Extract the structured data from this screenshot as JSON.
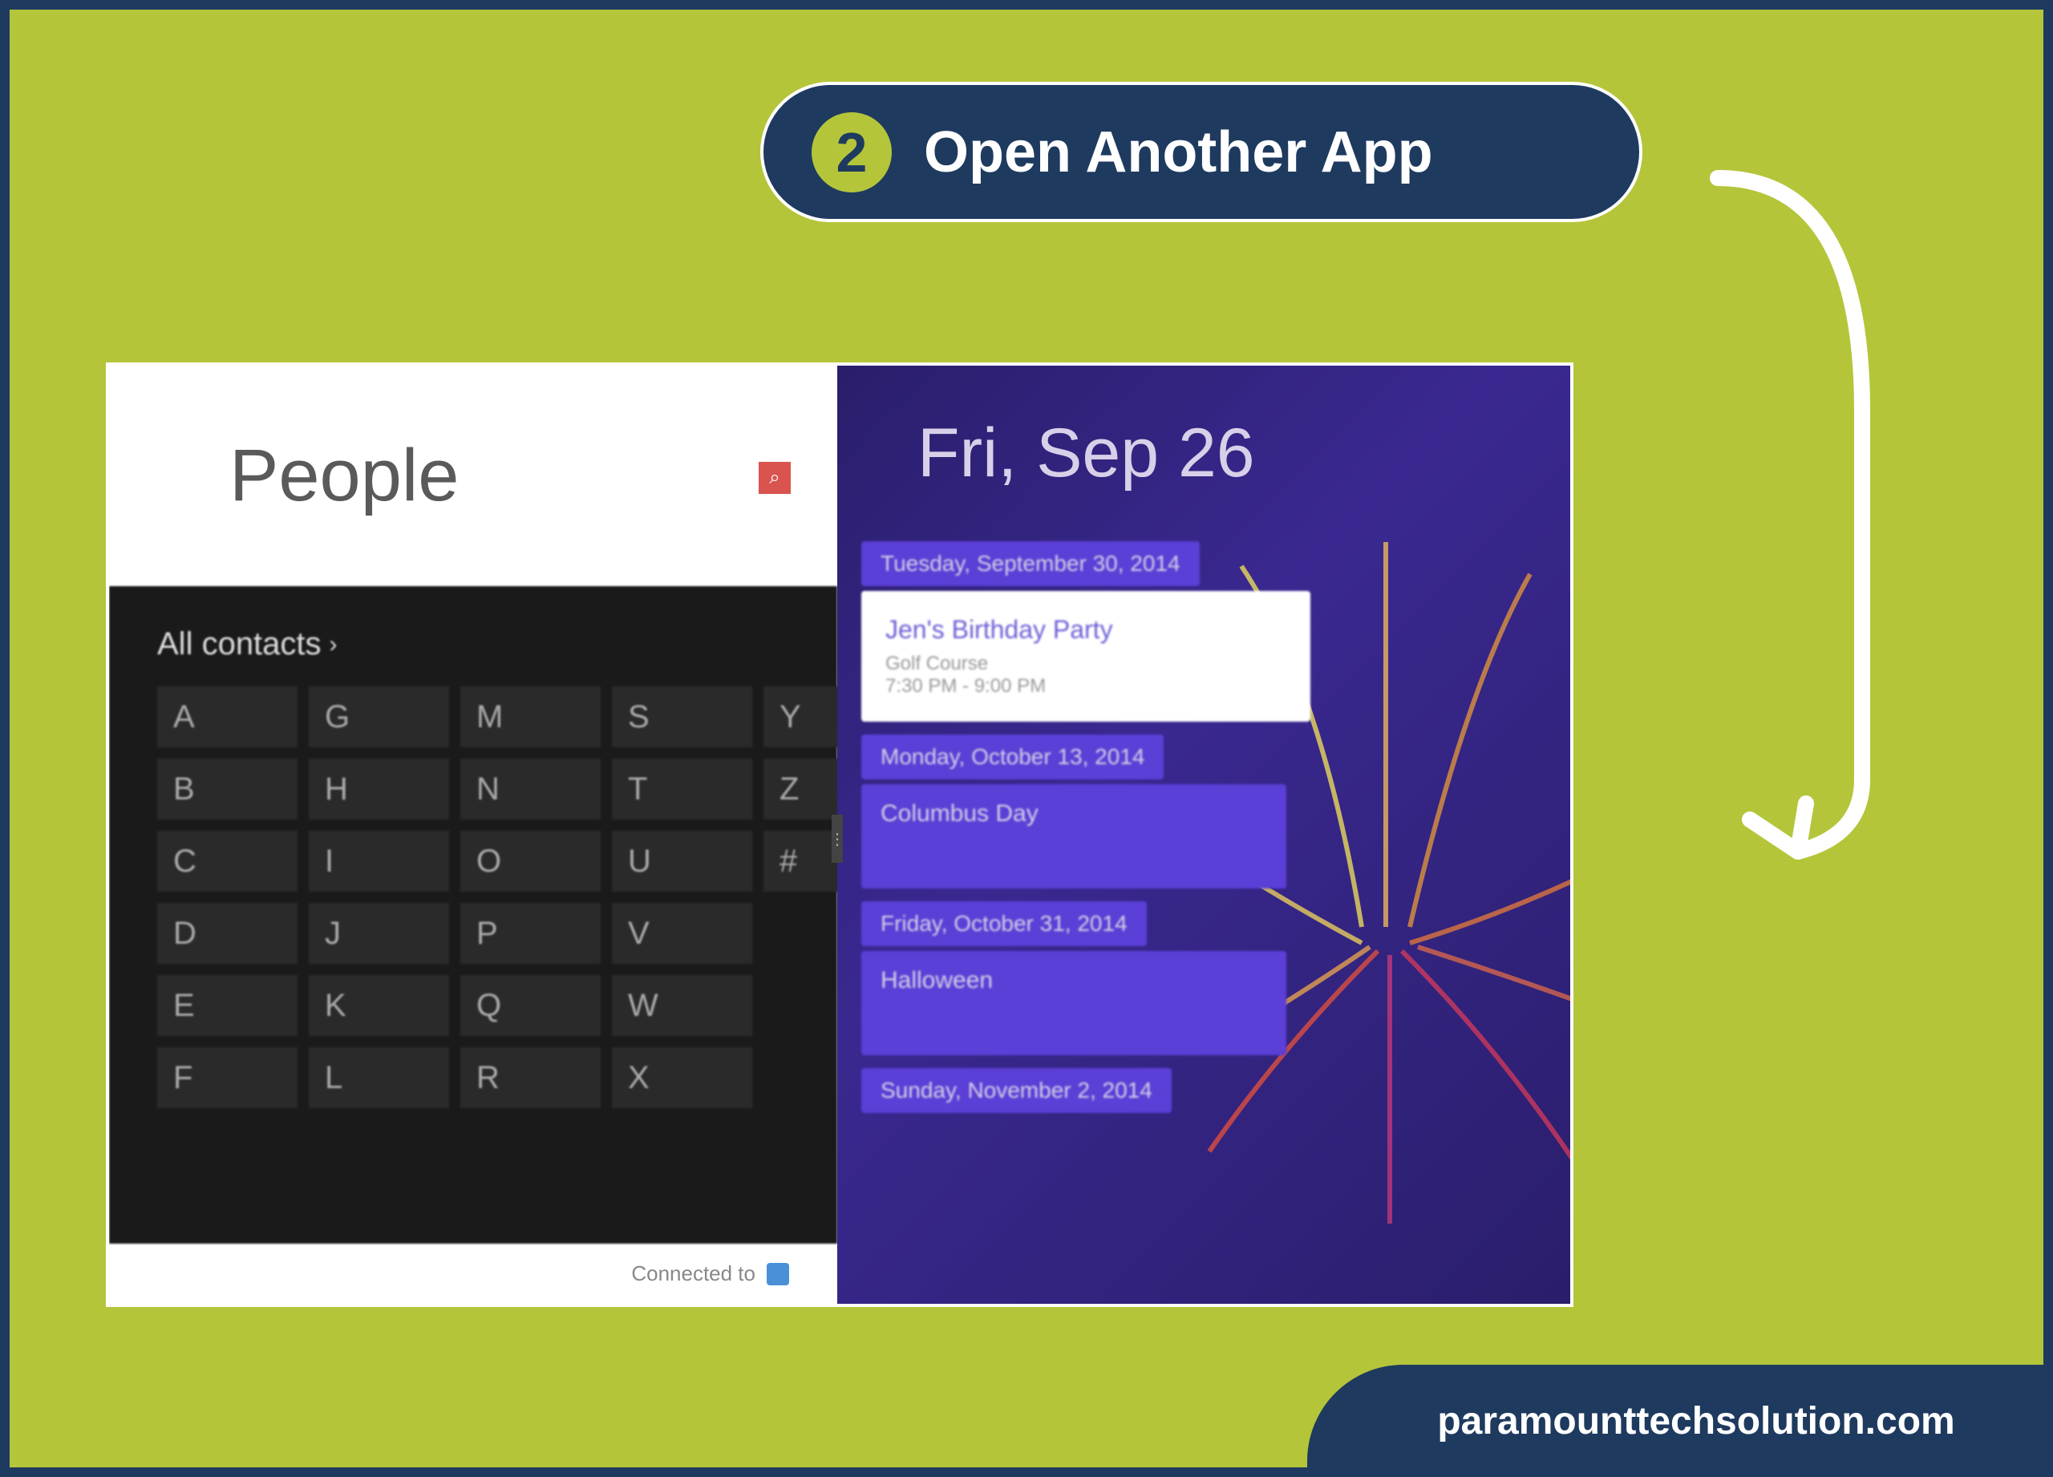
{
  "step": {
    "number": "2",
    "title": "Open Another App"
  },
  "people": {
    "title": "People",
    "all_contacts": "All contacts",
    "letters": [
      "A",
      "G",
      "M",
      "S",
      "Y",
      "B",
      "H",
      "N",
      "T",
      "Z",
      "C",
      "I",
      "O",
      "U",
      "#",
      "D",
      "J",
      "P",
      "V",
      "",
      "E",
      "K",
      "Q",
      "W",
      "",
      "F",
      "L",
      "R",
      "X",
      ""
    ],
    "footer": "Connected to"
  },
  "calendar": {
    "date": "Fri, Sep 26",
    "events": [
      {
        "type": "chip",
        "text": "Tuesday, September 30, 2014"
      },
      {
        "type": "white",
        "title": "Jen's Birthday Party",
        "sub1": "Golf Course",
        "sub2": "7:30 PM - 9:00 PM"
      },
      {
        "type": "chip",
        "text": "Monday, October 13, 2014"
      },
      {
        "type": "tall",
        "title": "Columbus Day"
      },
      {
        "type": "chip",
        "text": "Friday, October 31, 2014"
      },
      {
        "type": "tall",
        "title": "Halloween"
      },
      {
        "type": "chip",
        "text": "Sunday, November 2, 2014"
      }
    ]
  },
  "footer": {
    "domain": "paramounttechsolution.com"
  }
}
